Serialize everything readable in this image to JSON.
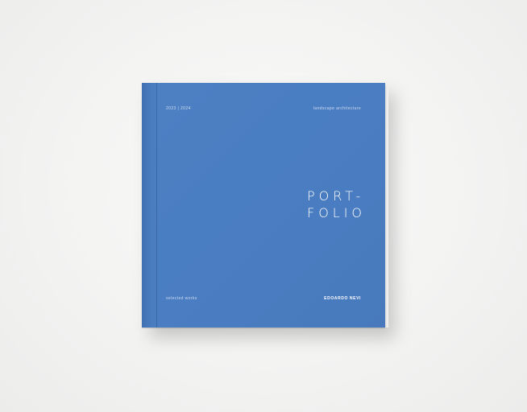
{
  "book": {
    "years": "2023 | 2024",
    "subject": "landscape architecture",
    "title_line1": "PORT-",
    "title_line2": "FOLIO",
    "tagline": "selected works",
    "author": "EDOARDO NEVI",
    "cover_color": "#4a7ec2"
  }
}
